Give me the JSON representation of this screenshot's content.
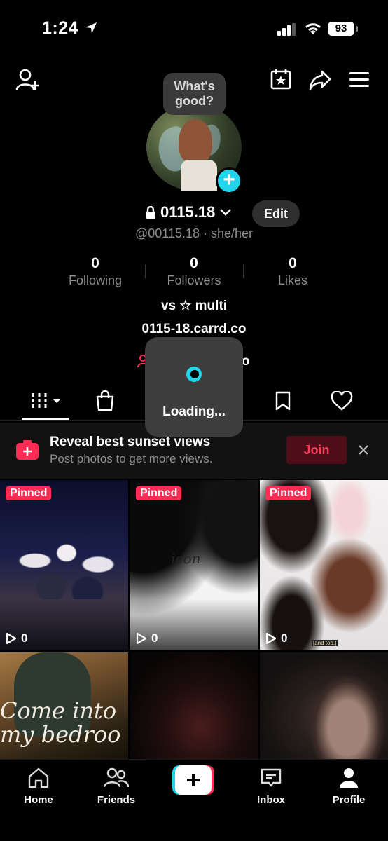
{
  "status_bar": {
    "time": "1:24",
    "battery": "93"
  },
  "profile": {
    "bubble": "What's\ngood?",
    "username": "0115.18",
    "edit_label": "Edit",
    "handle_line": "@00115.18 · she/her",
    "bio": "vs ☆ multi",
    "link": "0115-18.carrd.co",
    "stats": [
      {
        "number": "0",
        "label": "Following"
      },
      {
        "number": "0",
        "label": "Followers"
      },
      {
        "number": "0",
        "label": "Likes"
      }
    ]
  },
  "loading": {
    "text": "Loading..."
  },
  "promo": {
    "title": "Reveal best sunset views",
    "subtitle": "Post photos to get more views.",
    "join_label": "Join"
  },
  "grid": {
    "pinned_label": "Pinned",
    "tiles": [
      {
        "views": "0",
        "pinned": true
      },
      {
        "views": "0",
        "pinned": true,
        "caption": "icon"
      },
      {
        "views": "0",
        "pinned": true,
        "tag": "[and too.]"
      },
      {
        "caption": "Come into\nmy bedroo"
      },
      {},
      {}
    ]
  },
  "bottom_nav": [
    {
      "label": "Home"
    },
    {
      "label": "Friends"
    },
    {
      "label": "Inbox"
    },
    {
      "label": "Profile"
    }
  ],
  "colors": {
    "accent_cyan": "#20d5ec",
    "accent_red": "#fe2c55"
  }
}
